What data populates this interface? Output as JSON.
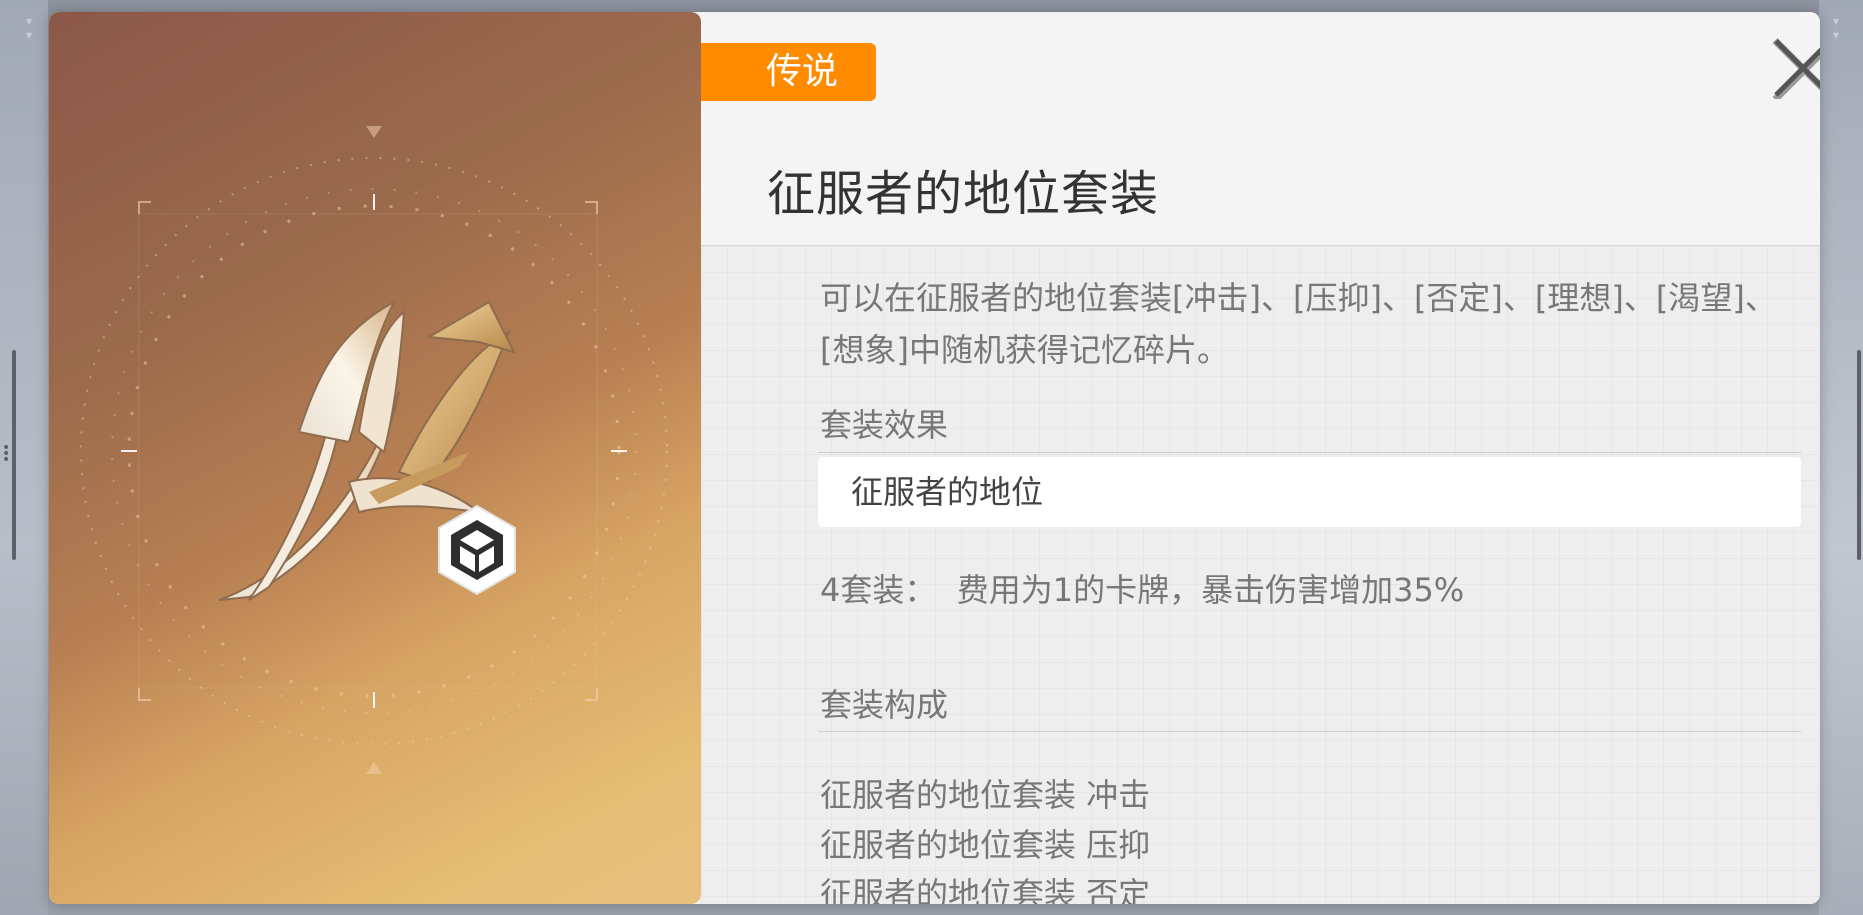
{
  "rarity": "传说",
  "title": "征服者的地位套装",
  "description": "可以在征服者的地位套装[冲击]、[压抑]、[否定]、[理想]、[渴望]、[想象]中随机获得记忆碎片。",
  "set_effect": {
    "label": "套装效果",
    "set_name": "征服者的地位",
    "bonus_prefix": "4套装：",
    "bonus_text": "费用为1的卡牌，暴击伤害增加35%"
  },
  "composition": {
    "label": "套装构成",
    "pieces": [
      "征服者的地位套装 冲击",
      "征服者的地位套装 压抑",
      "征服者的地位套装 否定"
    ]
  },
  "icons": {
    "close": "close-icon",
    "weapon": "blade-artwork",
    "type": "cube-icon"
  },
  "colors": {
    "rarity": "#ff8c00",
    "panel": "#f1f1f1"
  }
}
